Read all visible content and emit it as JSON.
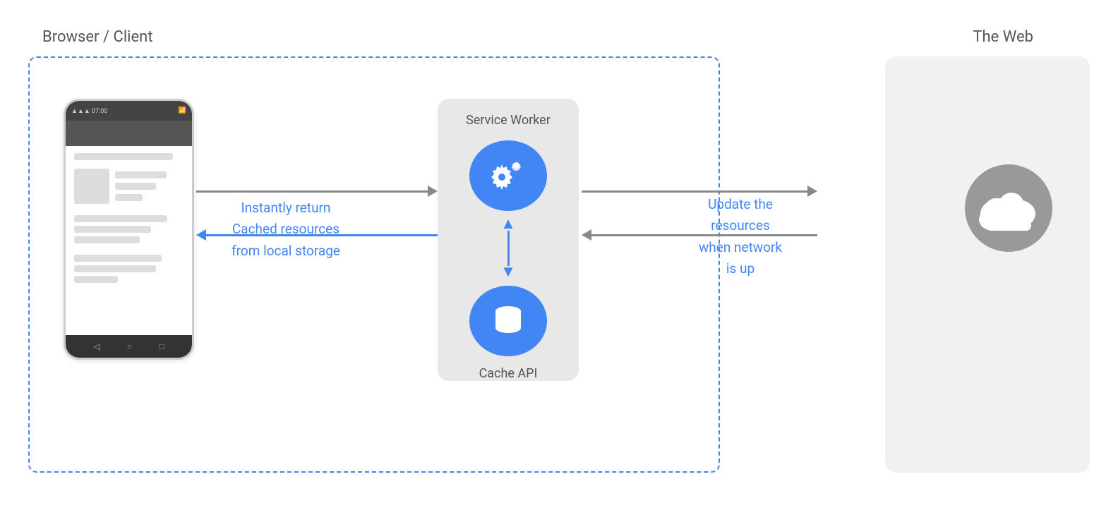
{
  "labels": {
    "browser_client": "Browser / Client",
    "the_web": "The Web",
    "service_worker": "Service Worker",
    "cache_api": "Cache API",
    "instantly_return": "Instantly return",
    "cached_resources": "Cached resources",
    "from_local_storage": "from local storage",
    "update_the": "Update the",
    "resources": "resources",
    "when_network": "when network",
    "is_up": "is up"
  },
  "colors": {
    "blue": "#4285F4",
    "dashed_border": "#4285F4",
    "arrow_gray": "#888888",
    "text_gray": "#555555",
    "light_bg": "#e8e8e8",
    "phone_bar": "#444444",
    "phone_line": "#dddddd",
    "cloud_bg": "#999999",
    "web_box_bg": "#f0f0f0"
  }
}
